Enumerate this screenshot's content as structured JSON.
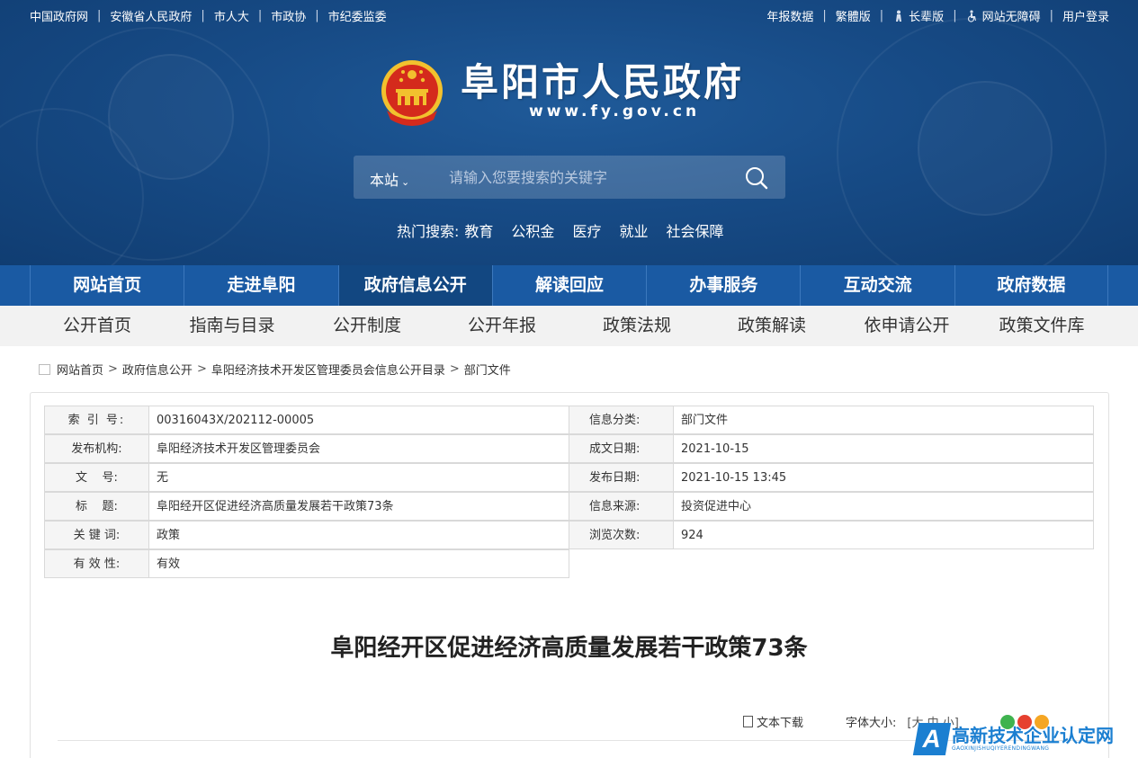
{
  "topbar": {
    "left_links": [
      "中国政府网",
      "安徽省人民政府",
      "市人大",
      "市政协",
      "市纪委监委"
    ],
    "right_links": [
      "年报数据",
      "繁體版",
      "长辈版",
      "网站无障碍",
      "用户登录"
    ]
  },
  "site": {
    "title": "阜阳市人民政府",
    "domain": "www.fy.gov.cn"
  },
  "search": {
    "scope": "本站",
    "placeholder": "请输入您要搜索的关键字"
  },
  "hot_search": {
    "label": "热门搜索:",
    "keywords": [
      "教育",
      "公积金",
      "医疗",
      "就业",
      "社会保障"
    ]
  },
  "main_nav": {
    "items": [
      "网站首页",
      "走进阜阳",
      "政府信息公开",
      "解读回应",
      "办事服务",
      "互动交流",
      "政府数据"
    ],
    "active": "政府信息公开"
  },
  "sub_nav": {
    "items": [
      "公开首页",
      "指南与目录",
      "公开制度",
      "公开年报",
      "政策法规",
      "政策解读",
      "依申请公开",
      "政策文件库"
    ]
  },
  "breadcrumb": [
    "网站首页",
    "政府信息公开",
    "阜阳经济技术开发区管理委员会信息公开目录",
    "部门文件"
  ],
  "meta": {
    "index_label": "索 引 号:",
    "index_value": "00316043X/202112-00005",
    "category_label": "信息分类:",
    "category_value": "部门文件",
    "publisher_label": "发布机构:",
    "publisher_value": "阜阳经济技术开发区管理委员会",
    "written_date_label": "成文日期:",
    "written_date_value": "2021-10-15",
    "doc_no_label": "文    号:",
    "doc_no_value": "无",
    "publish_date_label": "发布日期:",
    "publish_date_value": "2021-10-15 13:45",
    "title_label": "标    题:",
    "title_value": "阜阳经开区促进经济高质量发展若干政策73条",
    "source_label": "信息来源:",
    "source_value": "投资促进中心",
    "keyword_label": "关 键 词:",
    "keyword_value": "政策",
    "views_label": "浏览次数:",
    "views_value": "924",
    "validity_label": "有 效 性:",
    "validity_value": "有效"
  },
  "document": {
    "title": "阜阳经开区促进经济高质量发展若干政策73条"
  },
  "tools": {
    "download": "文本下载",
    "font_size_label": "字体大小:",
    "font_size_options": "[大 中 小]"
  },
  "watermark": {
    "cn": "高新技术企业认定网",
    "en": "GAOXINJISHUQIYERENDINGWANG"
  },
  "colors": {
    "header_blue": "#174b86",
    "nav_blue": "#1a5aa3",
    "nav_active": "#124781",
    "subnav_bg": "#f2f2f2"
  }
}
